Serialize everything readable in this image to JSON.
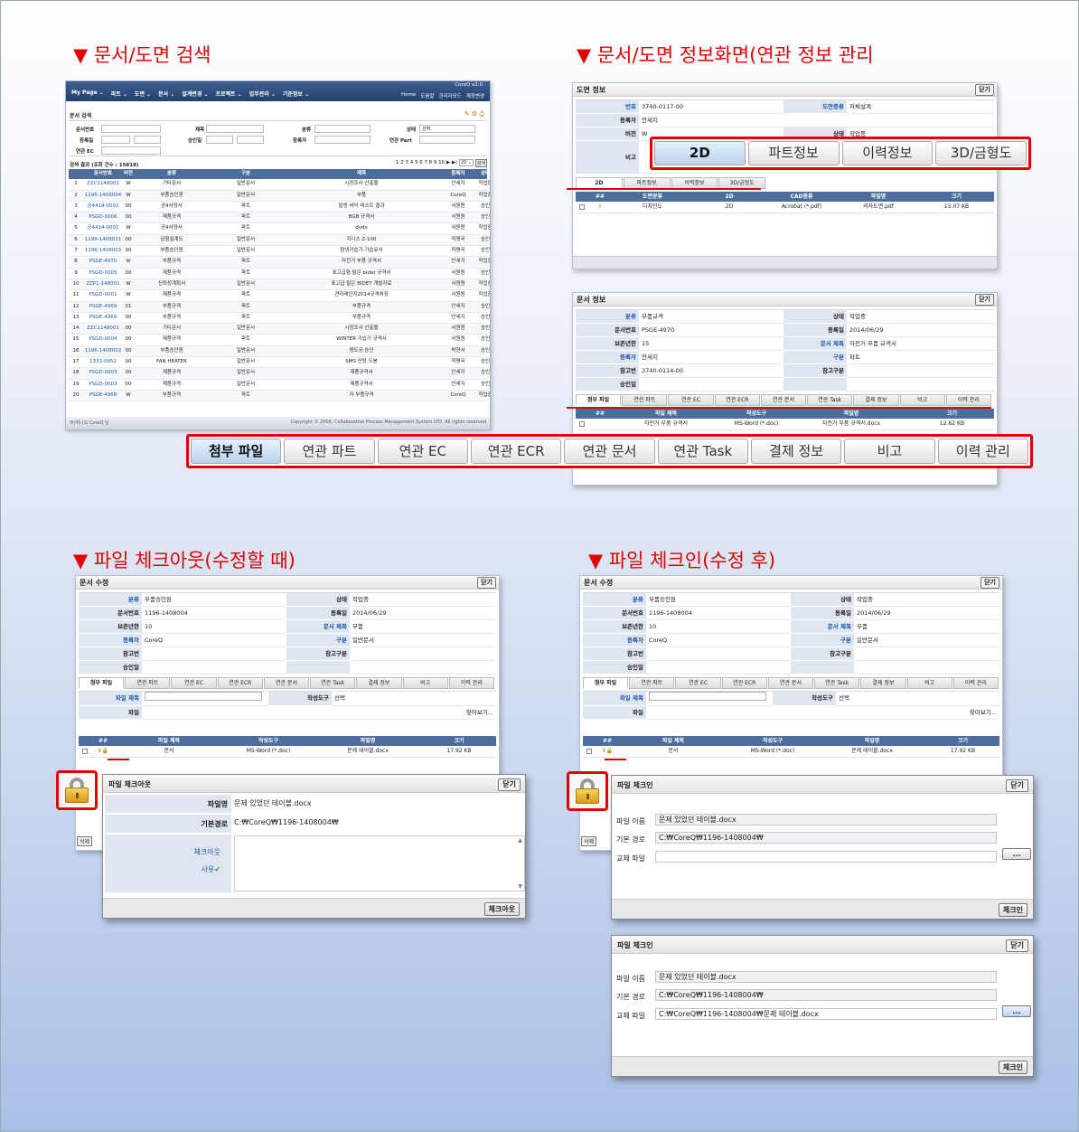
{
  "sections": {
    "s1": "▼ 문서/도면 검색",
    "s2": "▼ 문서/도면 정보화면(연관 정보 관리",
    "s3": "▼ 파일 체크아웃(수정할 때)",
    "s4": "▼ 파일 체크인(수정 후)"
  },
  "search": {
    "logo": "CoreQ v2.0",
    "nav": [
      "My Page ⌄",
      "파트 ⌄",
      "도면 ⌄",
      "문서 ⌄",
      "설계변경 ⌄",
      "프로젝트 ⌄",
      "업무관리 ⌄",
      "기준정보 ⌄"
    ],
    "util": [
      "Home",
      "도움말",
      "관리자모드",
      "계정변경"
    ],
    "title": "문서 검색",
    "filters": [
      "문서번호",
      "제목",
      "분류",
      "상태",
      "등록일",
      "승인일",
      "등록자",
      "연관 Part",
      "연관 EC"
    ],
    "status_value": "선택",
    "result_label": "검색 결과 (조회 건수 : 15818)",
    "pager": "1 2 3 4 5 6 7 8 9 10 ▶ ▶|",
    "page_size": "20 ⌄",
    "search_btn": "검색",
    "headers": [
      "",
      "문서번호",
      "버전",
      "분류",
      "구분",
      "제목",
      "등록자",
      "상태",
      "승인일"
    ],
    "rows": [
      [
        "1",
        "ZZC1148001",
        "W",
        "기타문서",
        "일반문서",
        "시장조사 산출물",
        "안세지",
        "작업중",
        ""
      ],
      [
        "2",
        "1196-1408004",
        "W",
        "부품승인원",
        "일반문서",
        "부품",
        "CoreQ",
        "작업중",
        ""
      ],
      [
        "3",
        "공4414-0002",
        "00",
        "공4사양서",
        "파트",
        "발생 바닥 테스트 결과",
        "서원원",
        "승인",
        "2014/08/29"
      ],
      [
        "4",
        "PSGD-0006",
        "00",
        "제품규격",
        "파트",
        "BGB 규격서",
        "서원원",
        "승인",
        ""
      ],
      [
        "5",
        "공4414-0001",
        "W",
        "공4사양서",
        "파트",
        "dvdv",
        "서원원",
        "작업중",
        ""
      ],
      [
        "6",
        "1199-1408011",
        "00",
        "금형설계도",
        "일반문서",
        "지니스 Z-100",
        "작명국",
        "승인",
        "2014/08/29"
      ],
      [
        "7",
        "1196-1408003",
        "00",
        "부품승인원",
        "일반문서",
        "탕냉가습기 가습유서",
        "작명국",
        "승인",
        "2014/08/29"
      ],
      [
        "8",
        "PSGE-4970",
        "W",
        "부품규격",
        "파트",
        "자전거 부품 규격서",
        "안세지",
        "작업중",
        ""
      ],
      [
        "9",
        "PSGD-0005",
        "00",
        "제품규격",
        "파트",
        "표고급형 탈은 bidet 규격서",
        "서원원",
        "승인",
        "2014/08/29"
      ],
      [
        "10",
        "ZZP1-148001",
        "W",
        "신뢰성계획서",
        "일반문서",
        "표고급 탈은 BIDET 개발자료",
        "서원원",
        "작업중",
        ""
      ],
      [
        "11",
        "PSGD-0001",
        "W",
        "제품규격",
        "파트",
        "견자레인지2014규격처정",
        "서원원",
        "작업중",
        ""
      ],
      [
        "12",
        "PSGE-4969",
        "01",
        "부품규격",
        "파트",
        "부품규격",
        "안세지",
        "승인",
        "2014/07/27"
      ],
      [
        "13",
        "PSGE-4969",
        "00",
        "부품규격",
        "파트",
        "부품규격",
        "안세지",
        "승인",
        "2014/07/27"
      ],
      [
        "14",
        "ZZC1148001",
        "00",
        "기타문서",
        "일반문서",
        "시장조사 산출물",
        "서원원",
        "승인",
        "2014/07/27"
      ],
      [
        "15",
        "PSGD-0004",
        "00",
        "제품규격",
        "파트",
        "WINTER 가습기 규격서",
        "서원원",
        "승인",
        "2014/07/27"
      ],
      [
        "16",
        "1196-1408002",
        "00",
        "부품승인원",
        "일반문서",
        "원도공 승인",
        "박현서",
        "승인",
        "2014/07/27"
      ],
      [
        "17",
        "1333-0052",
        "00",
        "FAN HEATER",
        "일반문서",
        "SMS 산탕 도봉",
        "작명국",
        "승인",
        "2014/08/29"
      ],
      [
        "18",
        "PSGD-0003",
        "00",
        "제품규격",
        "일반문서",
        "제품규격서",
        "안세지",
        "승인",
        "2014/07/27"
      ],
      [
        "19",
        "PSGD-0003",
        "00",
        "제품규격",
        "일반문서",
        "제품규격서",
        "안세지",
        "승인",
        "2014/07/27"
      ],
      [
        "20",
        "PSGE-4968",
        "W",
        "부품규격",
        "파트",
        "자 부품규격",
        "CoreQ",
        "작업중",
        ""
      ]
    ],
    "footer_left": "주)위나오 CoreQ 님",
    "footer_right": "Copyright © 2006, Collaborative Process Management System LTD. All rights reserved"
  },
  "drawing": {
    "title": "도면 정보",
    "close": "닫기",
    "fields": [
      {
        "l": "번호",
        "v": "3740-0117-00",
        "l2": "도면종류",
        "v2": "자체설계"
      },
      {
        "l": "등록자",
        "v": "안세지",
        "l2": "",
        "": ""
      },
      {
        "l": "버전",
        "v": "W",
        "l2": "상태",
        "v2": "작업중"
      },
      {
        "l": "비고",
        "v": ""
      }
    ],
    "tabs": [
      "2D",
      "파트정보",
      "이력정보",
      "3D/금형도"
    ],
    "headers": [
      "",
      "##",
      "도면분류",
      "2D",
      "CAD종류",
      "파일명",
      "크기"
    ],
    "row": [
      "",
      "",
      "디자인도",
      "2D",
      "Acrobat (*.pdf)",
      "의자도면.pdf",
      "15.07 KB"
    ]
  },
  "doc": {
    "title": "문서 정보",
    "close": "닫기",
    "fields": [
      [
        "분류",
        "부품규격",
        "상태",
        "작업중"
      ],
      [
        "문서번호",
        "PSGE-4970",
        "등록일",
        "2014/06/29"
      ],
      [
        "보존년한",
        "15",
        "문서 제목",
        "자전거 부품 규격서"
      ],
      [
        "등록자",
        "안세지",
        "구분",
        "파트"
      ],
      [
        "참고번",
        "3740-0114-00",
        "참고구분",
        ""
      ],
      [
        "승인일",
        "",
        "",
        ""
      ]
    ],
    "tabs": [
      "첨부 파일",
      "연관 파트",
      "연관 EC",
      "연관 ECR",
      "연관 문서",
      "연관 Task",
      "결제 정보",
      "비고",
      "이력 관리"
    ],
    "headers": [
      "",
      "##",
      "파일 제목",
      "작성도구",
      "파일명",
      "크기"
    ],
    "row": [
      "",
      "",
      "자전거 부품 규격서",
      "MS-Word (*.doc)",
      "자전거 부품 규격서.docx",
      "12.62 KB"
    ]
  },
  "tabs2d": [
    "2D",
    "파트정보",
    "이력정보",
    "3D/금형도"
  ],
  "tabsdoc": [
    "첨부 파일",
    "연관 파트",
    "연관 EC",
    "연관 ECR",
    "연관 문서",
    "연관 Task",
    "결제 정보",
    "비고",
    "이력 관리"
  ],
  "edit": {
    "title": "문서 수정",
    "close": "닫기",
    "fields": [
      [
        "분류",
        "부품승인원",
        "상태",
        "작업중"
      ],
      [
        "문서번호",
        "1196-1408004",
        "등록일",
        "2014/06/29"
      ],
      [
        "보존년한",
        "10",
        "문서 제목",
        "부품"
      ],
      [
        "등록자",
        "CoreQ",
        "구분",
        "일반문서"
      ],
      [
        "참고번",
        "",
        "참고구분",
        ""
      ],
      [
        "승인일",
        "",
        "",
        ""
      ]
    ],
    "tabs": [
      "첨부 파일",
      "연관 파트",
      "연관 EC",
      "연관 ECR",
      "연관 문서",
      "연관 Task",
      "결제 정보",
      "비고",
      "이력 관리"
    ],
    "file_title_label": "파일 제목",
    "tool_label": "작성도구",
    "tool_value": "선택",
    "file_label": "파일",
    "browse": "찾아보기...",
    "headers": [
      "",
      "##",
      "파일 제목",
      "작성도구",
      "파일명",
      "크기"
    ],
    "row": [
      "",
      "",
      "문서",
      "MS-Word (*.doc)",
      "문제 테이블.docx",
      "17.92 KB"
    ],
    "delete": "삭제"
  },
  "checkout": {
    "title": "파일 체크아웃",
    "close": "닫기",
    "file_label": "파일명",
    "file_value": "문제 있었던 테이블.docx",
    "path_label": "기본경로",
    "path_value": "C:₩CoreQ₩1196-1408004₩",
    "reason_label1": "체크아웃",
    "reason_label2": "사유",
    "btn": "체크아웃"
  },
  "checkin1": {
    "title": "파일 체크인",
    "close": "닫기",
    "file_label": "파일 이름",
    "file_value": "문제 있었던 테이블.docx",
    "path_label": "기본 경로",
    "path_value": "C:₩CoreQ₩1196-1408004₩",
    "repl_label": "교체 파일",
    "repl_value": "",
    "browse": "...",
    "btn": "체크인"
  },
  "checkin2": {
    "title": "파일 체크인",
    "close": "닫기",
    "file_label": "파일 이름",
    "file_value": "문제 있었던 테이블.docx",
    "path_label": "기본 경로",
    "path_value": "C:₩CoreQ₩1196-1408004₩",
    "repl_label": "교체 파일",
    "repl_value": "C:₩CoreQ₩1196-1408004₩문제 테이블.docx",
    "browse": "...",
    "btn": "체크인"
  }
}
